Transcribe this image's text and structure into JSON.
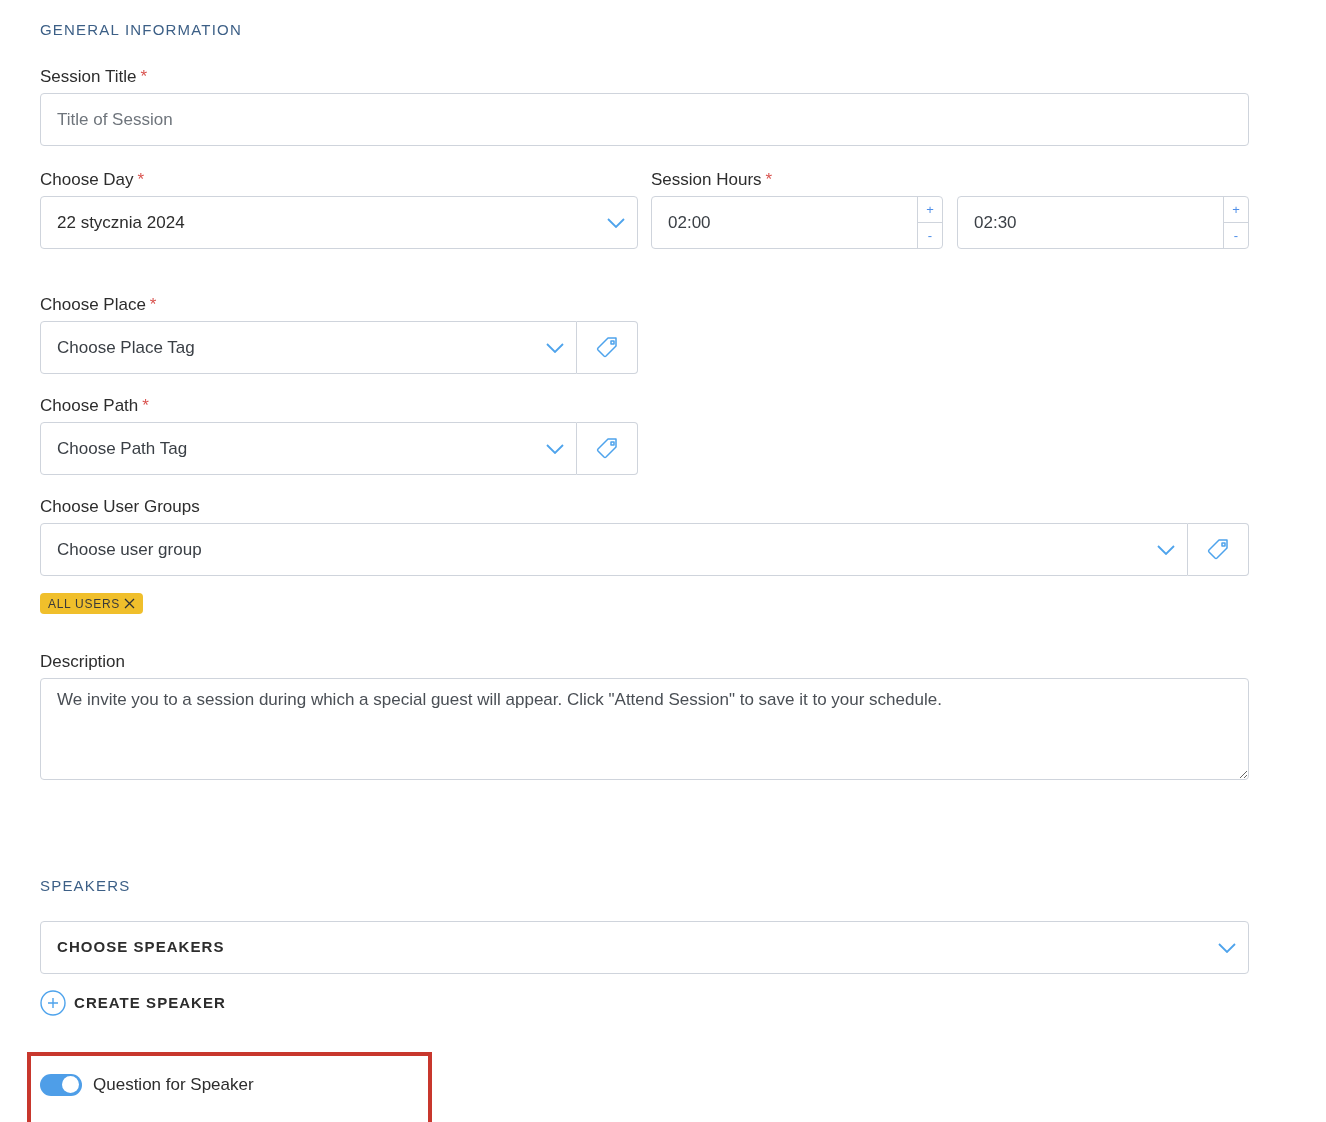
{
  "required_mark": "*",
  "general": {
    "heading": "GENERAL INFORMATION",
    "session_title": {
      "label": "Session Title",
      "required": true,
      "placeholder": "Title of Session"
    },
    "day": {
      "label": "Choose Day",
      "required": true,
      "value": "22 stycznia 2024"
    },
    "hours": {
      "label": "Session Hours",
      "required": true,
      "increment": "+",
      "decrement": "-",
      "times": [
        {
          "value": "02:00"
        },
        {
          "value": "02:30"
        }
      ]
    },
    "place": {
      "label": "Choose Place",
      "required": true,
      "placeholder": "Choose Place Tag"
    },
    "path": {
      "label": "Choose Path",
      "required": true,
      "placeholder": "Choose Path Tag"
    },
    "user_groups": {
      "label": "Choose User Groups",
      "required": false,
      "placeholder": "Choose user group",
      "tags": [
        {
          "label": "ALL USERS"
        }
      ]
    },
    "description": {
      "label": "Description",
      "value": "We invite you to a session during which a special guest will appear. Click \"Attend Session\" to save it to your schedule."
    }
  },
  "speakers": {
    "heading": "SPEAKERS",
    "select_placeholder": "CHOOSE SPEAKERS",
    "create_button": "CREATE SPEAKER"
  },
  "question_toggle": {
    "label": "Question for Speaker",
    "on": true
  }
}
